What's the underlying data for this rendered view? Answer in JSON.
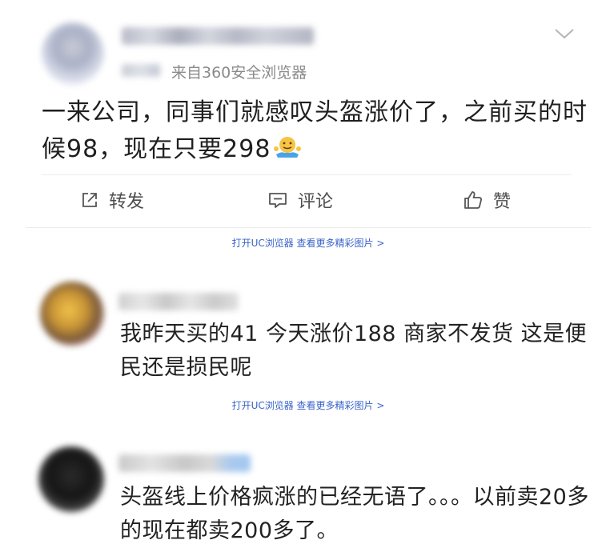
{
  "post": {
    "source": "来自360安全浏览器",
    "text": "一来公司，同事们就感叹头盔涨价了，之前买的时候98，现在只要298",
    "emoji": "shrug-emoji",
    "actions": {
      "repost": "转发",
      "comment": "评论",
      "like": "赞"
    }
  },
  "uc_prompts": [
    "打开UC浏览器 查看更多精彩图片 >",
    "打开UC浏览器 查看更多精彩图片 >"
  ],
  "comments": [
    {
      "text": "我昨天买的41 今天涨价188 商家不发货 这是便民还是损民呢"
    },
    {
      "text": "头盔线上价格疯涨的已经无语了。。。以前卖20多的现在都卖200多了。"
    }
  ],
  "colors": {
    "link": "#3a63c9",
    "text": "#1f1f1f",
    "muted": "#8a8a8a",
    "icon": "#4d4d4d"
  }
}
